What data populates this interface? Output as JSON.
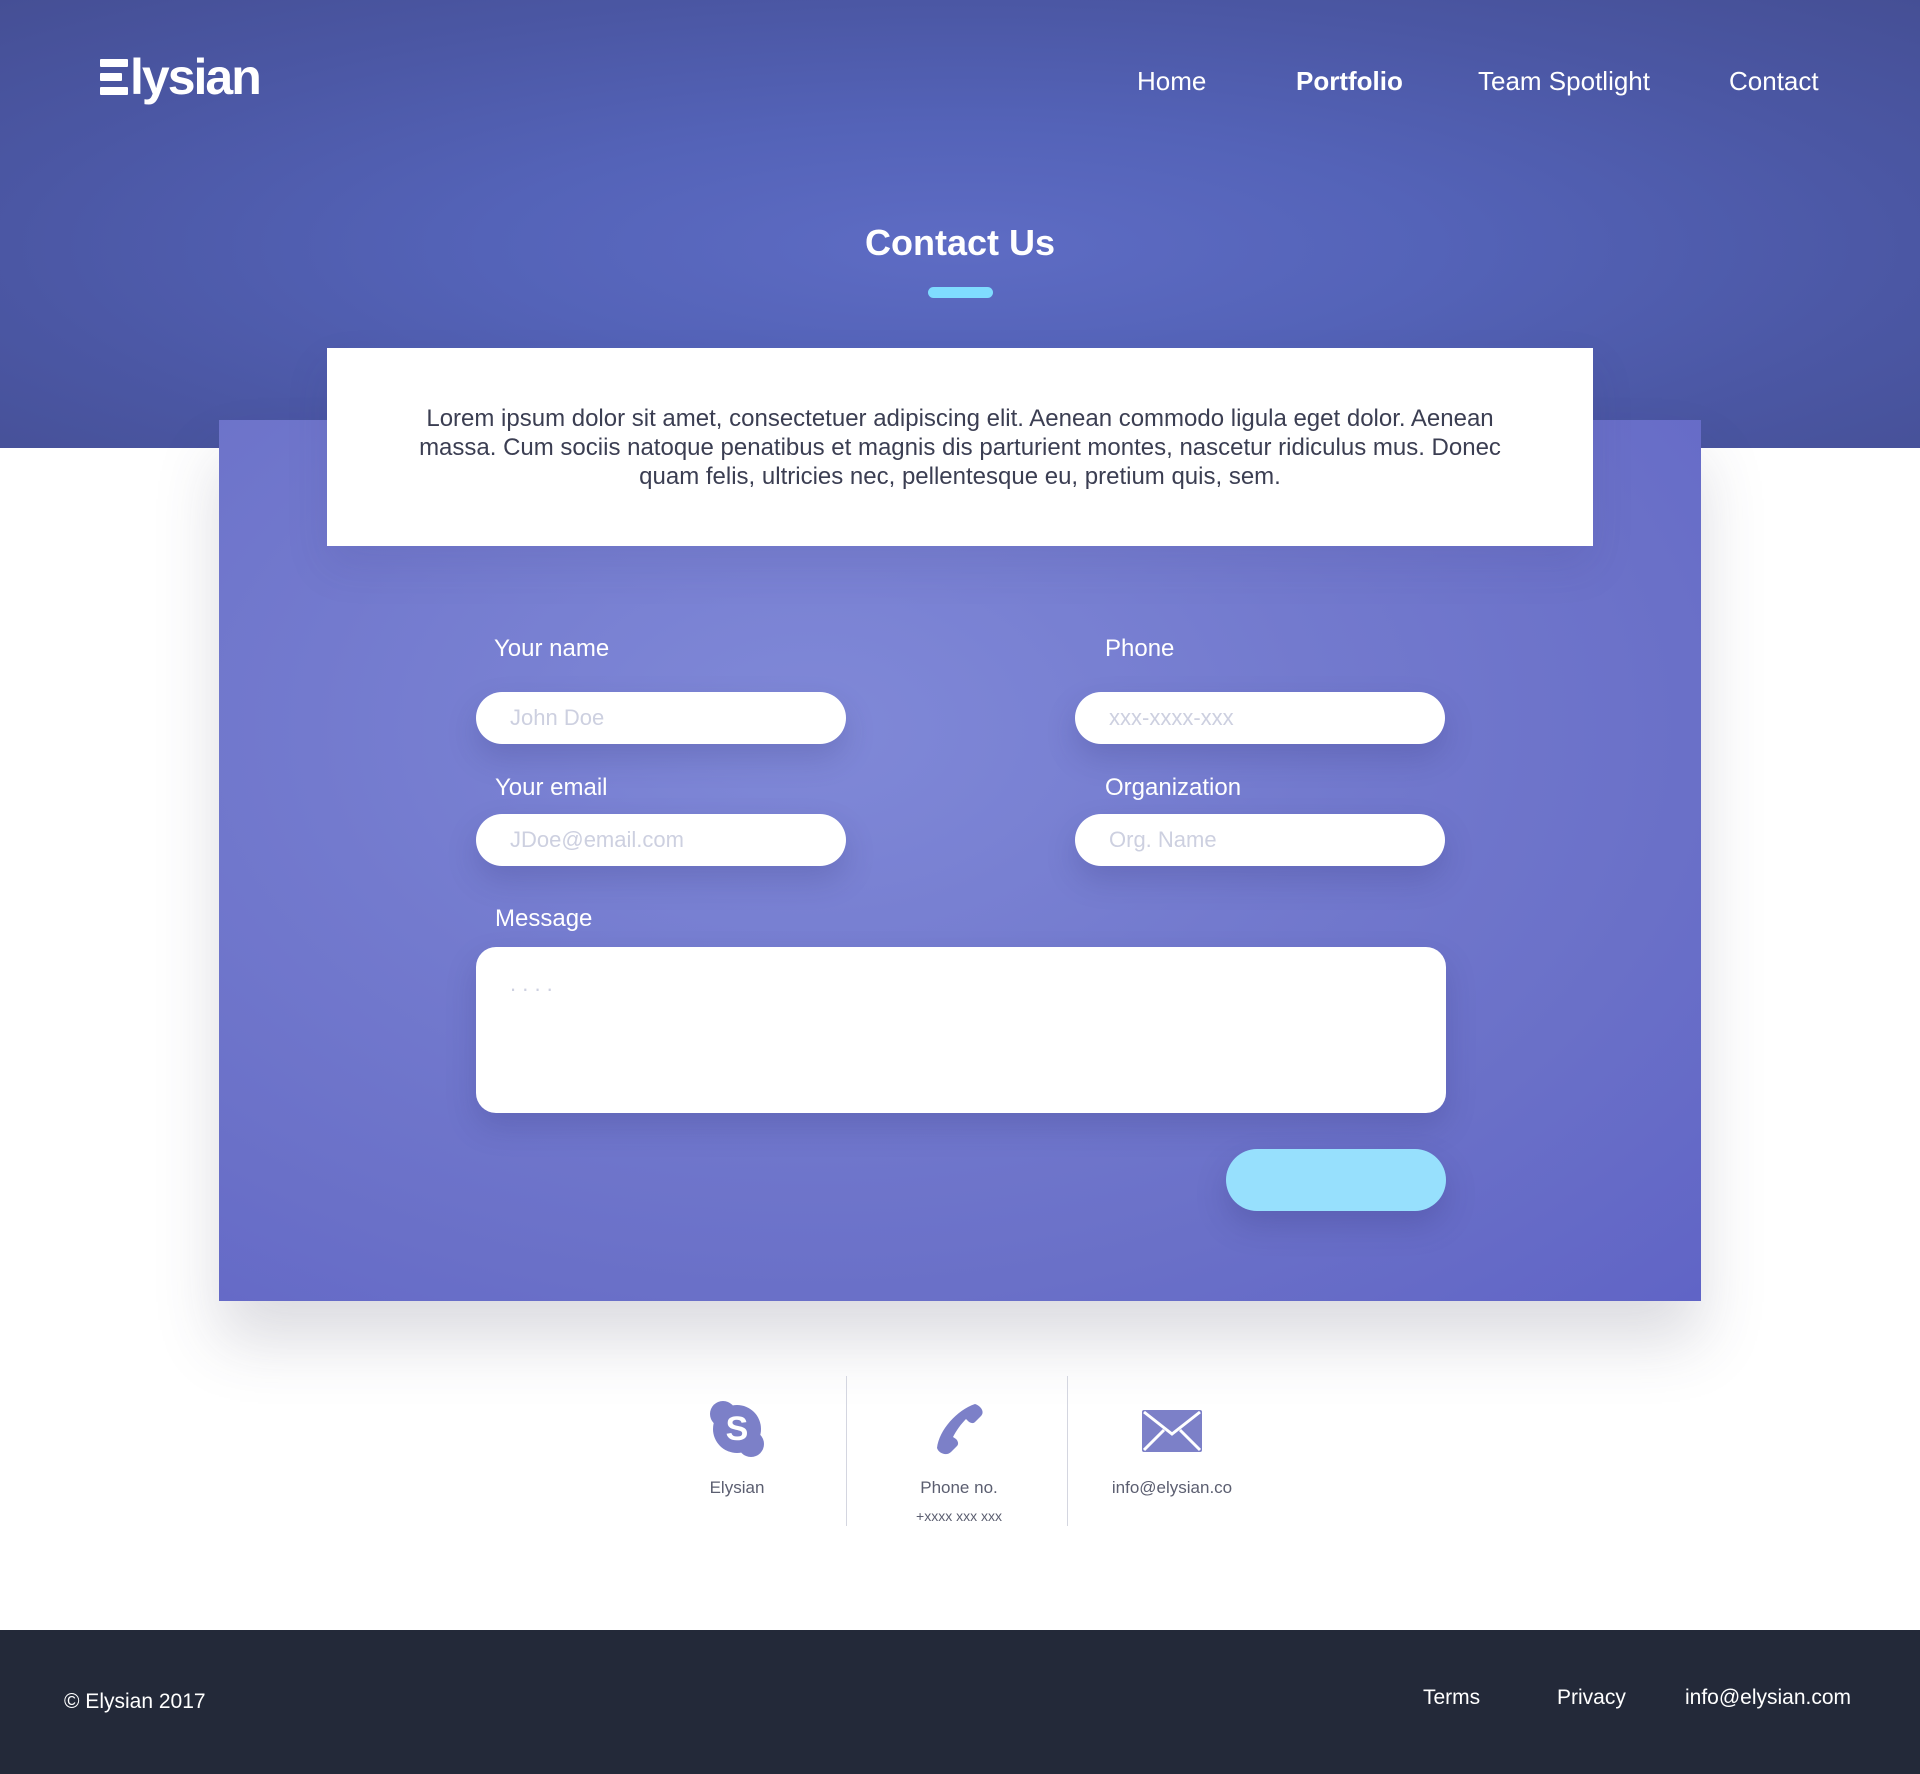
{
  "header": {
    "logo_text": "lysian",
    "nav": [
      {
        "label": "Home"
      },
      {
        "label": "Portfolio",
        "active": true
      },
      {
        "label": "Team Spotlight"
      },
      {
        "label": "Contact"
      }
    ]
  },
  "page": {
    "title": "Contact Us",
    "intro": "Lorem ipsum dolor sit amet, consectetuer adipiscing elit. Aenean commodo ligula eget dolor. Aenean massa. Cum sociis natoque penatibus et magnis dis parturient montes, nascetur ridiculus mus. Donec quam felis, ultricies nec, pellentesque eu, pretium quis, sem."
  },
  "form": {
    "name_label": "Your name",
    "name_placeholder": "John Doe",
    "phone_label": "Phone",
    "phone_placeholder": "xxx-xxxx-xxx",
    "email_label": "Your email",
    "email_placeholder": "JDoe@email.com",
    "org_label": "Organization",
    "org_placeholder": "Org. Name",
    "message_label": "Message",
    "message_placeholder": ". . . .",
    "submit_label": ""
  },
  "contacts": [
    {
      "icon": "skype-icon",
      "label": "Elysian",
      "sub": ""
    },
    {
      "icon": "phone-icon",
      "label": "Phone no.",
      "sub": "+xxxx xxx xxx"
    },
    {
      "icon": "mail-icon",
      "label": "info@elysian.co",
      "sub": ""
    }
  ],
  "footer": {
    "copyright": "© Elysian 2017",
    "links": [
      "Terms",
      "Privacy",
      "info@elysian.com"
    ]
  },
  "colors": {
    "hero": "#5463b8",
    "panel": "#737ace",
    "accent": "#97e0fd",
    "icon": "#7c80c8",
    "footer": "#232939"
  }
}
